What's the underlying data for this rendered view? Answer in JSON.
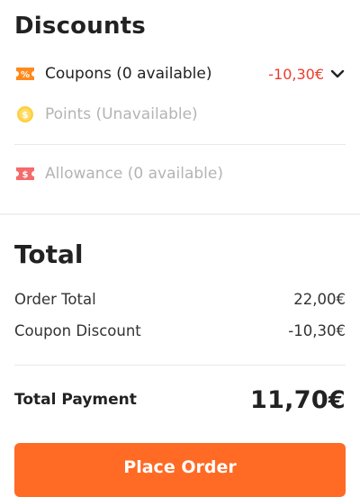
{
  "discounts": {
    "title": "Discounts",
    "coupons": {
      "label": "Coupons (0 available)",
      "amount": "-10,30€"
    },
    "points": {
      "label": "Points (Unavailable)"
    },
    "allowance": {
      "label": "Allowance (0 available)"
    }
  },
  "total": {
    "title": "Total",
    "order_total_label": "Order Total",
    "order_total_value": "22,00€",
    "coupon_discount_label": "Coupon Discount",
    "coupon_discount_value": "-10,30€",
    "payment_label": "Total Payment",
    "payment_value": "11,70€"
  },
  "actions": {
    "place_order_label": "Place Order"
  },
  "colors": {
    "accent": "#ff6a24",
    "discount_red": "#ee3b2b",
    "muted": "#b4b4b4"
  },
  "icons": {
    "coupons": "coupon-tag-icon",
    "points": "coin-icon",
    "allowance": "allowance-ticket-icon",
    "expand": "chevron-down-icon"
  }
}
